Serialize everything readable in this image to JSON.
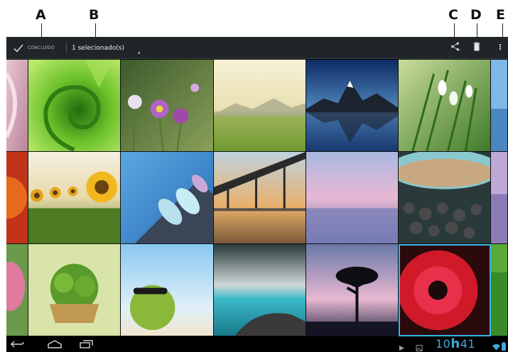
{
  "callouts": {
    "a": "A",
    "b": "B",
    "c": "C",
    "d": "D",
    "e": "E"
  },
  "action_bar": {
    "done_label": "CONCLUÍDO",
    "selection_label": "1 selecionado(s)"
  },
  "status_bar": {
    "time_prefix": "10",
    "time_hours_letter": "h",
    "time_minutes": "41"
  },
  "colors": {
    "action_bar_bg": "#1f2529",
    "clock_blue": "#3fa9d6",
    "selected_border": "#33b5e5"
  },
  "icons": [
    "check-icon",
    "share-icon",
    "trash-icon",
    "overflow-menu-icon",
    "back-icon",
    "home-icon",
    "recent-apps-icon",
    "wifi-icon",
    "battery-icon"
  ],
  "gallery": {
    "tiles": [
      "pink-petal-edge",
      "green-leaf-spiral",
      "purple-flowers",
      "green-field-landscape",
      "mountain-lake-reflection",
      "snowdrop-flowers",
      "blue-edge",
      "red-flower-edge",
      "sunflowers",
      "flip-flops-pool",
      "bridge-sunset",
      "pink-sky-sea",
      "stones-water-bowl",
      "pink-sky-edge",
      "pink-lotus-edge",
      "herb-basket",
      "green-apple-beach",
      "turquoise-sea-rocks",
      "tree-silhouette-sunset",
      "red-gerbera",
      "green-edge"
    ]
  }
}
